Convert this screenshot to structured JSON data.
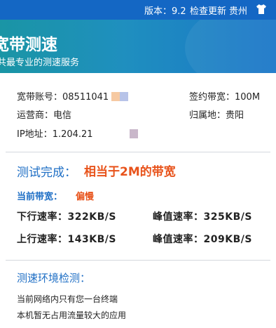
{
  "topbar": {
    "version": "版本：9.2",
    "check_update": "检查更新",
    "region": "贵州",
    "shirt_icon": "tshirt-icon",
    "bg_color": "#1467c4"
  },
  "banner": {
    "title": "宽带测速",
    "subtitle": "共最专业的测速服务"
  },
  "account": {
    "account_label": "宽带账号：",
    "account_value": "08511041",
    "plan_label": "签约带宽：",
    "plan_value": "100M",
    "isp_label": "运营商：",
    "isp_value": "电信",
    "location_label": "归属地：",
    "location_value": "贵阳",
    "ip_label": "IP地址：",
    "ip_value": "1.204.21"
  },
  "result": {
    "label": "测试完成：",
    "value": "相当于2M的带宽",
    "bandwidth_label": "当前带宽：",
    "bandwidth_value": "偏慢",
    "accent_color": "#e8531b"
  },
  "speeds": {
    "down_label": "下行速率：",
    "down_value": "322KB/S",
    "down_peak_label": "峰值速率：",
    "down_peak_value": "325KB/S",
    "up_label": "上行速率：",
    "up_value": "143KB/S",
    "up_peak_label": "峰值速率：",
    "up_peak_value": "209KB/S"
  },
  "environment": {
    "title": "测速环境检测：",
    "line1": "当前网络内只有您一台终端",
    "line2": "本机暂无占用流量较大的应用"
  }
}
